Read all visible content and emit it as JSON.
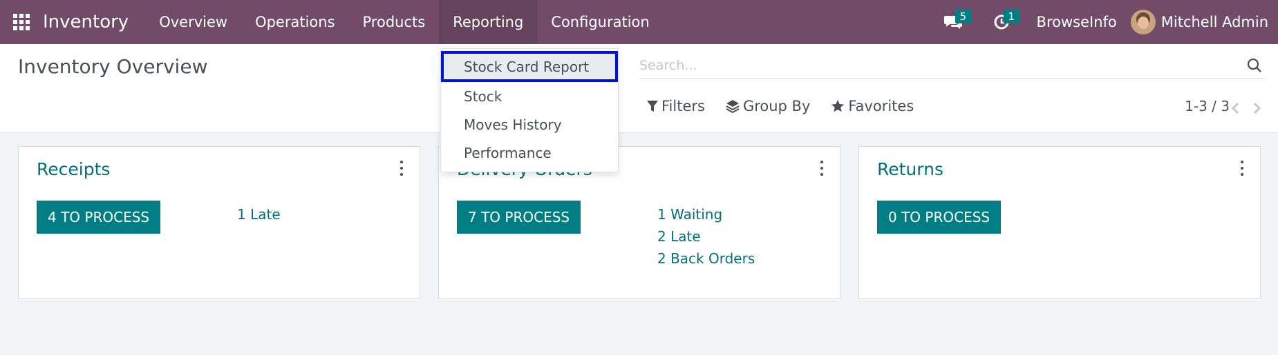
{
  "navbar": {
    "app_name": "Inventory",
    "menu": [
      "Overview",
      "Operations",
      "Products",
      "Reporting",
      "Configuration"
    ],
    "messages_count": "5",
    "activities_count": "1",
    "company": "BrowseInfo",
    "user": "Mitchell Admin",
    "bg_color": "#714b67"
  },
  "control_panel": {
    "title": "Inventory Overview",
    "search_placeholder": "Search...",
    "filters_label": "Filters",
    "group_by_label": "Group By",
    "favorites_label": "Favorites",
    "pager": "1-3 / 3"
  },
  "dropdown": {
    "items": [
      "Stock Card Report",
      "Stock",
      "Moves History",
      "Performance"
    ],
    "highlighted": "Stock Card Report"
  },
  "cards": [
    {
      "title": "Receipts",
      "button": "4 TO PROCESS",
      "stats": [
        "1 Late"
      ]
    },
    {
      "title": "Delivery Orders",
      "button": "7 TO PROCESS",
      "stats": [
        "1 Waiting",
        "2 Late",
        "2 Back Orders"
      ]
    },
    {
      "title": "Returns",
      "button": "0 TO PROCESS",
      "stats": []
    }
  ],
  "colors": {
    "accent": "#017e84",
    "link": "#00707a",
    "highlight_border": "#0015d4"
  }
}
